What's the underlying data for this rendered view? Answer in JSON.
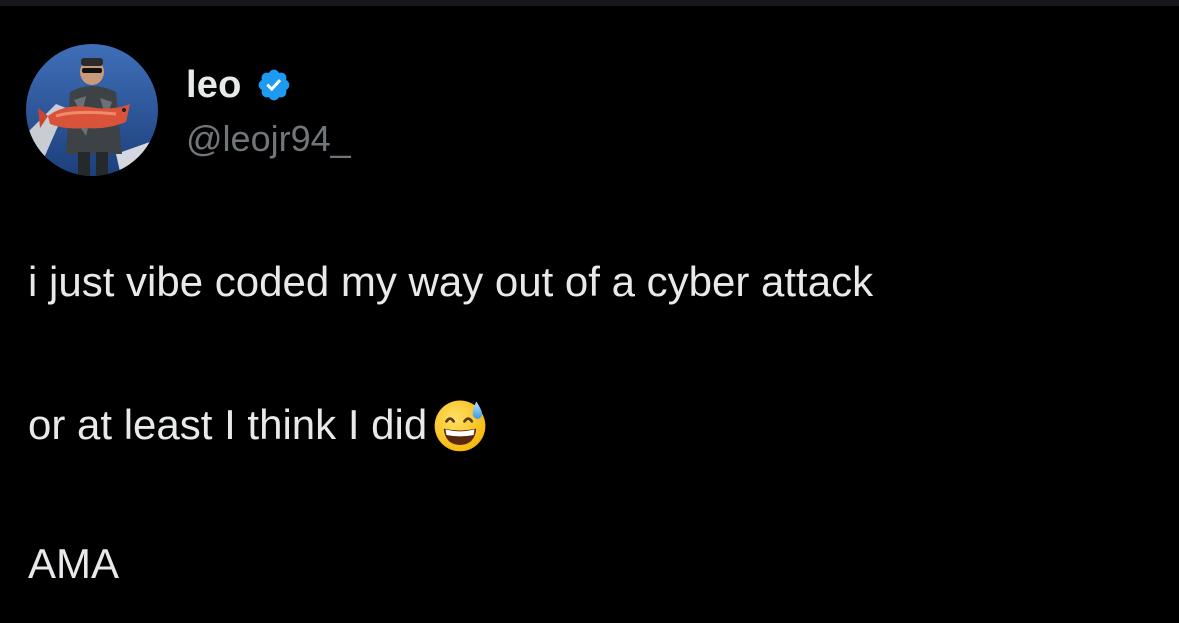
{
  "tweet": {
    "author": {
      "display_name": "leo",
      "handle": "@leojr94_",
      "verified": true,
      "verified_color": "#1d9bf0",
      "avatar_icon": "profile-photo-fisherman-with-red-snapper"
    },
    "text_lines": [
      "i just vibe coded my way out of a cyber attack",
      "or at least I think I did",
      "AMA"
    ],
    "emoji": "grinning-face-with-sweat-icon"
  },
  "colors": {
    "background": "#000000",
    "primary_text": "#e7e9ea",
    "secondary_text": "#71767b"
  }
}
